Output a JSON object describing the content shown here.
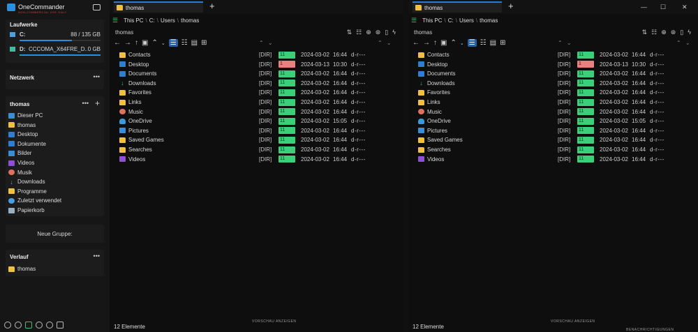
{
  "app": {
    "name": "OneCommander",
    "tagline": "NON-COMMERCIAL USE ONLY"
  },
  "sidebar": {
    "drives_title": "Laufwerke",
    "drives": [
      {
        "letter": "C:",
        "name": "",
        "usage": "88 / 135 GB",
        "fill": 0.65
      },
      {
        "letter": "D:",
        "name": "CCCOMA_X64FRE_D...",
        "usage": "0 GB",
        "fill": 1.0
      }
    ],
    "network_title": "Netzwerk",
    "favorites_title": "thomas",
    "favorites": [
      {
        "label": "Dieser PC",
        "icon": "pc-icon"
      },
      {
        "label": "thomas",
        "icon": "folder-icon"
      },
      {
        "label": "Desktop",
        "icon": "desktop-icon"
      },
      {
        "label": "Dokumente",
        "icon": "documents-icon"
      },
      {
        "label": "Bilder",
        "icon": "pictures-icon"
      },
      {
        "label": "Videos",
        "icon": "videos-icon"
      },
      {
        "label": "Musik",
        "icon": "music-icon"
      },
      {
        "label": "Downloads",
        "icon": "download-icon"
      },
      {
        "label": "Programme",
        "icon": "folder-icon"
      },
      {
        "label": "Zuletzt verwendet",
        "icon": "recent-icon"
      },
      {
        "label": "Papierkorb",
        "icon": "recycle-bin-icon"
      }
    ],
    "new_group": "Neue Gruppe:",
    "history_title": "Verlauf",
    "history": [
      {
        "label": "thomas"
      }
    ]
  },
  "panes": [
    {
      "tab": "thomas",
      "breadcrumb": [
        "This PC",
        "C:",
        "Users",
        "thomas"
      ],
      "current": "thomas",
      "status": "12 Elemente",
      "preview": "VORSCHAU ANZEIGEN"
    },
    {
      "tab": "thomas",
      "breadcrumb": [
        "This PC",
        "C:",
        "Users",
        "thomas"
      ],
      "current": "thomas",
      "status": "12 Elemente",
      "preview": "VORSCHAU ANZEIGEN",
      "notifications": "BENACHRICHTIGUNGEN"
    }
  ],
  "files": [
    {
      "name": "Contacts",
      "icon": "folder-icon",
      "type": "[DIR]",
      "age": "11",
      "recent": false,
      "date": "2024-03-02",
      "time": "16:44",
      "attr": "d-r---"
    },
    {
      "name": "Desktop",
      "icon": "desktop-icon",
      "type": "[DIR]",
      "age": "1",
      "recent": true,
      "date": "2024-03-13",
      "time": "10:30",
      "attr": "d-r---"
    },
    {
      "name": "Documents",
      "icon": "documents-icon",
      "type": "[DIR]",
      "age": "11",
      "recent": false,
      "date": "2024-03-02",
      "time": "16:44",
      "attr": "d-r---"
    },
    {
      "name": "Downloads",
      "icon": "download-icon",
      "type": "[DIR]",
      "age": "11",
      "recent": false,
      "date": "2024-03-02",
      "time": "16:44",
      "attr": "d-r---"
    },
    {
      "name": "Favorites",
      "icon": "folder-icon",
      "type": "[DIR]",
      "age": "11",
      "recent": false,
      "date": "2024-03-02",
      "time": "16:44",
      "attr": "d-r---"
    },
    {
      "name": "Links",
      "icon": "folder-icon",
      "type": "[DIR]",
      "age": "11",
      "recent": false,
      "date": "2024-03-02",
      "time": "16:44",
      "attr": "d-r---"
    },
    {
      "name": "Music",
      "icon": "music-icon",
      "type": "[DIR]",
      "age": "11",
      "recent": false,
      "date": "2024-03-02",
      "time": "16:44",
      "attr": "d-r---"
    },
    {
      "name": "OneDrive",
      "icon": "cloud-icon",
      "type": "[DIR]",
      "age": "11",
      "recent": false,
      "date": "2024-03-02",
      "time": "15:05",
      "attr": "d-r---"
    },
    {
      "name": "Pictures",
      "icon": "pictures-icon",
      "type": "[DIR]",
      "age": "11",
      "recent": false,
      "date": "2024-03-02",
      "time": "16:44",
      "attr": "d-r---"
    },
    {
      "name": "Saved Games",
      "icon": "folder-icon",
      "type": "[DIR]",
      "age": "11",
      "recent": false,
      "date": "2024-03-02",
      "time": "16:44",
      "attr": "d-r---"
    },
    {
      "name": "Searches",
      "icon": "folder-icon",
      "type": "[DIR]",
      "age": "11",
      "recent": false,
      "date": "2024-03-02",
      "time": "16:44",
      "attr": "d-r---"
    },
    {
      "name": "Videos",
      "icon": "videos-icon",
      "type": "[DIR]",
      "age": "11",
      "recent": false,
      "date": "2024-03-02",
      "time": "16:44",
      "attr": "d-r---"
    }
  ],
  "colors": {
    "accent": "#2b7bd4",
    "age_ok": "#3ad07a",
    "age_recent": "#e88080",
    "folder": "#f0c040"
  }
}
